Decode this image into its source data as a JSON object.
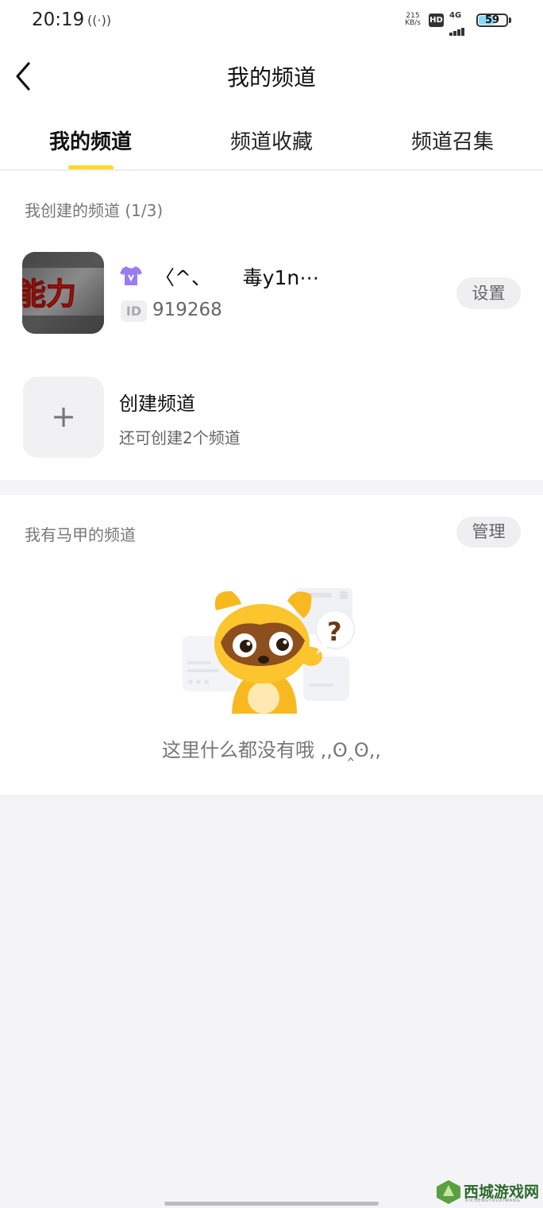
{
  "status_bar": {
    "time": "20:19",
    "hotspot_glyph": "((·))",
    "speed_value": "215",
    "speed_unit": "KB/s",
    "hd": "HD",
    "network": "4G",
    "battery": "59",
    "battery_level": 0.59
  },
  "header": {
    "title": "我的频道",
    "back_icon": "chevron-left-icon"
  },
  "tabs": [
    {
      "label": "我的频道",
      "active": true
    },
    {
      "label": "频道收藏",
      "active": false
    },
    {
      "label": "频道召集",
      "active": false
    }
  ],
  "created_section": {
    "title": "我创建的频道 (1/3)",
    "channel": {
      "avatar_text": "能力",
      "name": "〈^、     毒y1n⋯",
      "id_label": "ID",
      "id": "919268",
      "settings_label": "设置"
    },
    "create": {
      "icon": "+",
      "title": "创建频道",
      "subtitle": "还可创建2个频道"
    }
  },
  "alt_section": {
    "title": "我有马甲的频道",
    "manage_label": "管理",
    "empty_text": "这里什么都没有哦 ,,ʘ‸ʘ,,"
  },
  "watermark": {
    "text": "西城游戏网",
    "sub": "XICHENGYOUXIWANG"
  },
  "colors": {
    "accent": "#ffd629",
    "background": "#f4f4f6",
    "card": "#ffffff"
  }
}
